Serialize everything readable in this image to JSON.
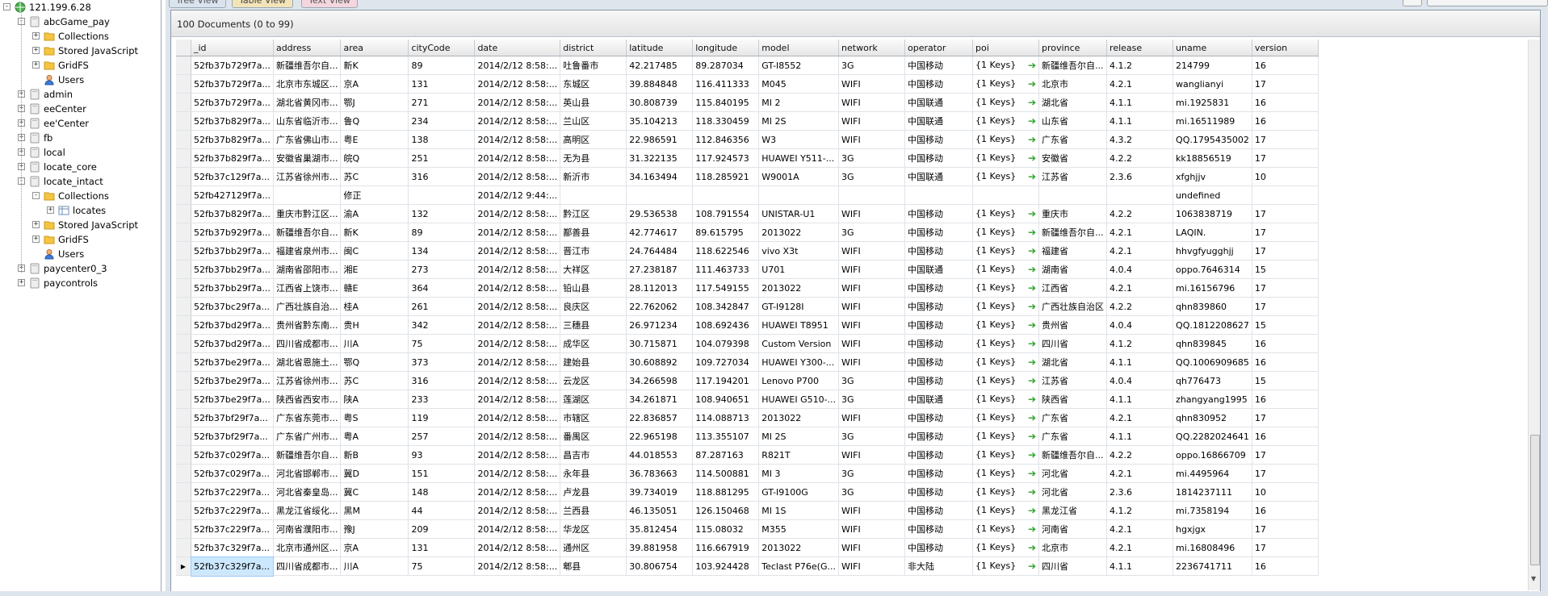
{
  "tree": {
    "server": "121.199.6.28",
    "databases": [
      {
        "name": "abcGame_pay",
        "expanded": true,
        "children": [
          "Collections",
          "Stored JavaScript",
          "GridFS",
          "Users"
        ]
      },
      {
        "name": "admin"
      },
      {
        "name": "eeCenter"
      },
      {
        "name": "ee'Center"
      },
      {
        "name": "fb"
      },
      {
        "name": "local"
      },
      {
        "name": "locate_core"
      },
      {
        "name": "locate_intact",
        "expanded": true,
        "children": [
          "Collections",
          "locates",
          "Stored JavaScript",
          "GridFS",
          "Users"
        ]
      },
      {
        "name": "paycenter0_3"
      },
      {
        "name": "paycontrols"
      }
    ]
  },
  "tabs": [
    "Tree View",
    "Table View",
    "Text View"
  ],
  "doc_count": "100 Documents (0 to 99)",
  "columns": [
    "_id",
    "address",
    "area",
    "cityCode",
    "date",
    "district",
    "latitude",
    "longitude",
    "model",
    "network",
    "operator",
    "poi",
    "province",
    "release",
    "uname",
    "version"
  ],
  "rows": [
    [
      "52fb37b729f7a...",
      "新疆维吾尔自...",
      "新K",
      "89",
      "2014/2/12 8:58:...",
      "吐鲁番市",
      "42.217485",
      "89.287034",
      "GT-I8552",
      "3G",
      "中国移动",
      "{1 Keys}",
      "新疆维吾尔自...",
      "4.1.2",
      "214799",
      "16"
    ],
    [
      "52fb37b729f7a...",
      "北京市东城区...",
      "京A",
      "131",
      "2014/2/12 8:58:...",
      "东城区",
      "39.884848",
      "116.411333",
      "M045",
      "WIFI",
      "中国移动",
      "{1 Keys}",
      "北京市",
      "4.2.1",
      "wanglianyi",
      "17"
    ],
    [
      "52fb37b729f7a...",
      "湖北省黄冈市...",
      "鄂J",
      "271",
      "2014/2/12 8:58:...",
      "英山县",
      "30.808739",
      "115.840195",
      "MI 2",
      "WIFI",
      "中国联通",
      "{1 Keys}",
      "湖北省",
      "4.1.1",
      "mi.1925831",
      "16"
    ],
    [
      "52fb37b829f7a...",
      "山东省临沂市...",
      "鲁Q",
      "234",
      "2014/2/12 8:58:...",
      "兰山区",
      "35.104213",
      "118.330459",
      "MI 2S",
      "WIFI",
      "中国联通",
      "{1 Keys}",
      "山东省",
      "4.1.1",
      "mi.16511989",
      "16"
    ],
    [
      "52fb37b829f7a...",
      "广东省佛山市...",
      "粤E",
      "138",
      "2014/2/12 8:58:...",
      "高明区",
      "22.986591",
      "112.846356",
      "W3",
      "WIFI",
      "中国移动",
      "{1 Keys}",
      "广东省",
      "4.3.2",
      "QQ.1795435002",
      "17"
    ],
    [
      "52fb37b829f7a...",
      "安徽省巢湖市...",
      "皖Q",
      "251",
      "2014/2/12 8:58:...",
      "无为县",
      "31.322135",
      "117.924573",
      "HUAWEI Y511-...",
      "3G",
      "中国移动",
      "{1 Keys}",
      "安徽省",
      "4.2.2",
      "kk18856519",
      "17"
    ],
    [
      "52fb37c129f7a...",
      "江苏省徐州市...",
      "苏C",
      "316",
      "2014/2/12 8:58:...",
      "新沂市",
      "34.163494",
      "118.285921",
      "W9001A",
      "3G",
      "中国联通",
      "{1 Keys}",
      "江苏省",
      "2.3.6",
      "xfghjjv",
      "10"
    ],
    [
      "52fb427129f7a...",
      "",
      "修正",
      "",
      "2014/2/12 9:44:...",
      "",
      "",
      "",
      "",
      "",
      "",
      "",
      "",
      "",
      "undefined",
      ""
    ],
    [
      "52fb37b829f7a...",
      "重庆市黔江区...",
      "渝A",
      "132",
      "2014/2/12 8:58:...",
      "黔江区",
      "29.536538",
      "108.791554",
      "UNISTAR-U1",
      "WIFI",
      "中国移动",
      "{1 Keys}",
      "重庆市",
      "4.2.2",
      "1063838719",
      "17"
    ],
    [
      "52fb37b929f7a...",
      "新疆维吾尔自...",
      "新K",
      "89",
      "2014/2/12 8:58:...",
      "鄯善县",
      "42.774617",
      "89.615795",
      "2013022",
      "3G",
      "中国移动",
      "{1 Keys}",
      "新疆维吾尔自...",
      "4.2.1",
      "LAQIN.",
      "17"
    ],
    [
      "52fb37bb29f7a...",
      "福建省泉州市...",
      "闽C",
      "134",
      "2014/2/12 8:58:...",
      "晋江市",
      "24.764484",
      "118.622546",
      "vivo X3t",
      "WIFI",
      "中国移动",
      "{1 Keys}",
      "福建省",
      "4.2.1",
      "hhvgfyugghjj",
      "17"
    ],
    [
      "52fb37bb29f7a...",
      "湖南省邵阳市...",
      "湘E",
      "273",
      "2014/2/12 8:58:...",
      "大祥区",
      "27.238187",
      "111.463733",
      "U701",
      "WIFI",
      "中国联通",
      "{1 Keys}",
      "湖南省",
      "4.0.4",
      "oppo.7646314",
      "15"
    ],
    [
      "52fb37bb29f7a...",
      "江西省上饶市...",
      "赣E",
      "364",
      "2014/2/12 8:58:...",
      "铅山县",
      "28.112013",
      "117.549155",
      "2013022",
      "WIFI",
      "中国移动",
      "{1 Keys}",
      "江西省",
      "4.2.1",
      "mi.16156796",
      "17"
    ],
    [
      "52fb37bc29f7a...",
      "广西壮族自治...",
      "桂A",
      "261",
      "2014/2/12 8:58:...",
      "良庆区",
      "22.762062",
      "108.342847",
      "GT-I9128I",
      "WIFI",
      "中国移动",
      "{1 Keys}",
      "广西壮族自治区",
      "4.2.2",
      "qhn839860",
      "17"
    ],
    [
      "52fb37bd29f7a...",
      "贵州省黔东南...",
      "贵H",
      "342",
      "2014/2/12 8:58:...",
      "三穗县",
      "26.971234",
      "108.692436",
      "HUAWEI T8951",
      "WIFI",
      "中国移动",
      "{1 Keys}",
      "贵州省",
      "4.0.4",
      "QQ.1812208627",
      "15"
    ],
    [
      "52fb37bd29f7a...",
      "四川省成都市...",
      "川A",
      "75",
      "2014/2/12 8:58:...",
      "成华区",
      "30.715871",
      "104.079398",
      "Custom Version",
      "WIFI",
      "中国移动",
      "{1 Keys}",
      "四川省",
      "4.1.2",
      "qhn839845",
      "16"
    ],
    [
      "52fb37be29f7a...",
      "湖北省恩施土...",
      "鄂Q",
      "373",
      "2014/2/12 8:58:...",
      "建始县",
      "30.608892",
      "109.727034",
      "HUAWEI Y300-...",
      "WIFI",
      "中国移动",
      "{1 Keys}",
      "湖北省",
      "4.1.1",
      "QQ.1006909685",
      "16"
    ],
    [
      "52fb37be29f7a...",
      "江苏省徐州市...",
      "苏C",
      "316",
      "2014/2/12 8:58:...",
      "云龙区",
      "34.266598",
      "117.194201",
      "Lenovo P700",
      "3G",
      "中国移动",
      "{1 Keys}",
      "江苏省",
      "4.0.4",
      "qh776473",
      "15"
    ],
    [
      "52fb37be29f7a...",
      "陕西省西安市...",
      "陕A",
      "233",
      "2014/2/12 8:58:...",
      "莲湖区",
      "34.261871",
      "108.940651",
      "HUAWEI G510-...",
      "3G",
      "中国联通",
      "{1 Keys}",
      "陕西省",
      "4.1.1",
      "zhangyang1995",
      "16"
    ],
    [
      "52fb37bf29f7a...",
      "广东省东莞市...",
      "粤S",
      "119",
      "2014/2/12 8:58:...",
      "市辖区",
      "22.836857",
      "114.088713",
      "2013022",
      "WIFI",
      "中国移动",
      "{1 Keys}",
      "广东省",
      "4.2.1",
      "qhn830952",
      "17"
    ],
    [
      "52fb37bf29f7a...",
      "广东省广州市...",
      "粤A",
      "257",
      "2014/2/12 8:58:...",
      "番禺区",
      "22.965198",
      "113.355107",
      "MI 2S",
      "3G",
      "中国移动",
      "{1 Keys}",
      "广东省",
      "4.1.1",
      "QQ.2282024641",
      "16"
    ],
    [
      "52fb37c029f7a...",
      "新疆维吾尔自...",
      "新B",
      "93",
      "2014/2/12 8:58:...",
      "昌吉市",
      "44.018553",
      "87.287163",
      "R821T",
      "WIFI",
      "中国移动",
      "{1 Keys}",
      "新疆维吾尔自...",
      "4.2.2",
      "oppo.16866709",
      "17"
    ],
    [
      "52fb37c029f7a...",
      "河北省邯郸市...",
      "冀D",
      "151",
      "2014/2/12 8:58:...",
      "永年县",
      "36.783663",
      "114.500881",
      "MI 3",
      "3G",
      "中国移动",
      "{1 Keys}",
      "河北省",
      "4.2.1",
      "mi.4495964",
      "17"
    ],
    [
      "52fb37c229f7a...",
      "河北省秦皇岛...",
      "冀C",
      "148",
      "2014/2/12 8:58:...",
      "卢龙县",
      "39.734019",
      "118.881295",
      "GT-I9100G",
      "3G",
      "中国移动",
      "{1 Keys}",
      "河北省",
      "2.3.6",
      "1814237111",
      "10"
    ],
    [
      "52fb37c229f7a...",
      "黑龙江省绥化...",
      "黑M",
      "44",
      "2014/2/12 8:58:...",
      "兰西县",
      "46.135051",
      "126.150468",
      "MI 1S",
      "WIFI",
      "中国移动",
      "{1 Keys}",
      "黑龙江省",
      "4.1.2",
      "mi.7358194",
      "16"
    ],
    [
      "52fb37c229f7a...",
      "河南省濮阳市...",
      "豫J",
      "209",
      "2014/2/12 8:58:...",
      "华龙区",
      "35.812454",
      "115.08032",
      "M355",
      "WIFI",
      "中国移动",
      "{1 Keys}",
      "河南省",
      "4.2.1",
      "hgxjgx",
      "17"
    ],
    [
      "52fb37c329f7a...",
      "北京市通州区...",
      "京A",
      "131",
      "2014/2/12 8:58:...",
      "通州区",
      "39.881958",
      "116.667919",
      "2013022",
      "WIFI",
      "中国移动",
      "{1 Keys}",
      "北京市",
      "4.2.1",
      "mi.16808496",
      "17"
    ],
    [
      "52fb37c329f7a...",
      "四川省成都市...",
      "川A",
      "75",
      "2014/2/12 8:58:...",
      "郫县",
      "30.806754",
      "103.924428",
      "Teclast P76e(G...",
      "WIFI",
      "非大陆",
      "{1 Keys}",
      "四川省",
      "4.1.1",
      "2236741711",
      "16"
    ]
  ],
  "selected_row": 27,
  "colors": {
    "accent": "#cce8ff",
    "poi_arrow": "#2aa22a",
    "panel_bg": "#dfe5ec"
  }
}
